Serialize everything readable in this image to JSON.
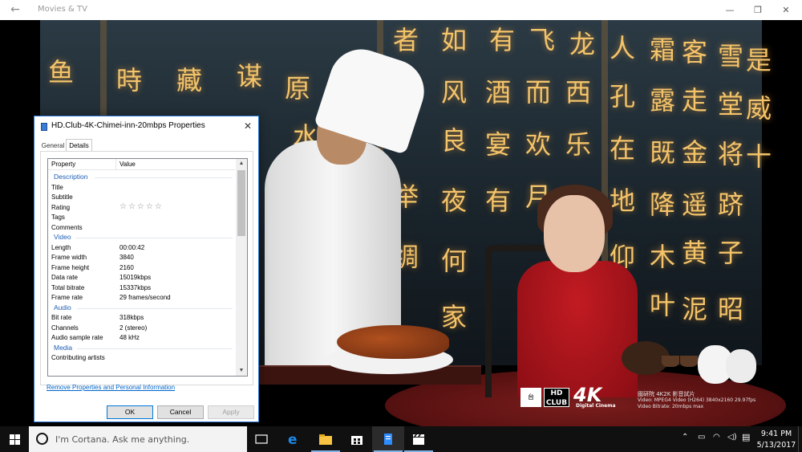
{
  "app": {
    "title": "Movies & TV",
    "back_icon": "arrow-left-icon"
  },
  "video": {
    "seal_text": "台",
    "hd_text": "HD\nCLUB",
    "logo_4k": "4K",
    "logo_4k_sub": "Digital Cinema",
    "caption_line1": "國研院 4K2K 影音試片",
    "caption_line2": "Video: MPEG4 Video (H264) 3840x2160 29.97fps",
    "caption_line3": "Video Bitrate: 20mbps max"
  },
  "dialog": {
    "title": "HD.Club-4K-Chimei-inn-20mbps Properties",
    "tabs": [
      "General",
      "Details"
    ],
    "columns": {
      "property": "Property",
      "value": "Value"
    },
    "sections": {
      "description": "Description",
      "video": "Video",
      "audio": "Audio",
      "media": "Media"
    },
    "description_rows": [
      {
        "property": "Title",
        "value": ""
      },
      {
        "property": "Subtitle",
        "value": ""
      },
      {
        "property": "Rating",
        "value": "☆☆☆☆☆"
      },
      {
        "property": "Tags",
        "value": ""
      },
      {
        "property": "Comments",
        "value": ""
      }
    ],
    "video_rows": [
      {
        "property": "Length",
        "value": "00:00:42"
      },
      {
        "property": "Frame width",
        "value": "3840"
      },
      {
        "property": "Frame height",
        "value": "2160"
      },
      {
        "property": "Data rate",
        "value": "15019kbps"
      },
      {
        "property": "Total bitrate",
        "value": "15337kbps"
      },
      {
        "property": "Frame rate",
        "value": "29 frames/second"
      }
    ],
    "audio_rows": [
      {
        "property": "Bit rate",
        "value": "318kbps"
      },
      {
        "property": "Channels",
        "value": "2 (stereo)"
      },
      {
        "property": "Audio sample rate",
        "value": "48 kHz"
      }
    ],
    "media_rows": [
      {
        "property": "Contributing artists",
        "value": ""
      }
    ],
    "remove_link": "Remove Properties and Personal Information",
    "buttons": {
      "ok": "OK",
      "cancel": "Cancel",
      "apply": "Apply"
    }
  },
  "taskbar": {
    "search_placeholder": "I'm Cortana. Ask me anything.",
    "time": "9:41 PM",
    "date": "5/13/2017",
    "accent": "#0078d7"
  }
}
